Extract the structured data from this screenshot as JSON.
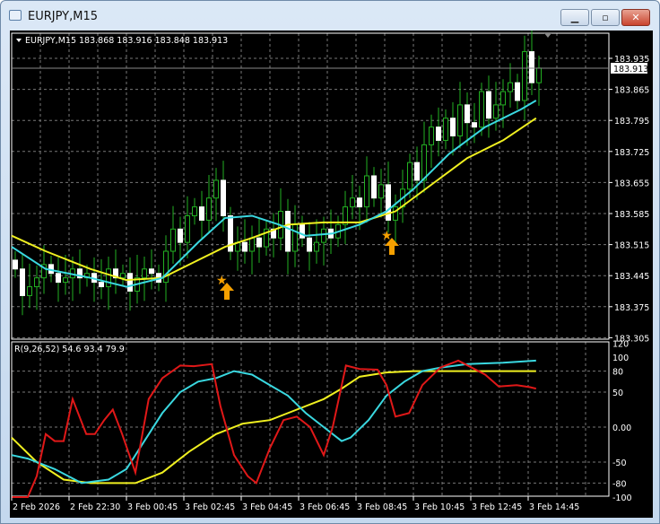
{
  "window": {
    "title": "EURJPY,M15",
    "minimize_icon": "minimize-icon",
    "maximize_icon": "maximize-icon",
    "close_icon": "close-icon"
  },
  "main": {
    "header": "EURJPY,M15  183.868 183.916 183.848 183.913",
    "current_price": "183.913",
    "price_labels": [
      "183.935",
      "183.865",
      "183.795",
      "183.725",
      "183.655",
      "183.585",
      "183.515",
      "183.445",
      "183.375",
      "183.305"
    ]
  },
  "indicator": {
    "header": "R(9,26,52) 54.6 93.4 79.9",
    "levels": [
      "120",
      "100",
      "80",
      "50",
      "0.00",
      "-50",
      "-80",
      "-100"
    ]
  },
  "time_labels": [
    "2 Feb 2026",
    "2 Feb 22:30",
    "3 Feb 00:45",
    "3 Feb 02:45",
    "3 Feb 04:45",
    "3 Feb 06:45",
    "3 Feb 08:45",
    "3 Feb 10:45",
    "3 Feb 12:45",
    "3 Feb 14:45"
  ],
  "colors": {
    "bull": "#ffffff",
    "bear": "#ffffff",
    "wick": "#22b022",
    "ma_fast": "#3ad8e0",
    "ma_slow": "#f0f020",
    "rsi_red": "#e01818",
    "rsi_cyan": "#3ad8e0",
    "rsi_yellow": "#f0f020",
    "signal": "#f5a000"
  },
  "chart_data": {
    "type": "candlestick",
    "symbol": "EURJPY",
    "timeframe": "M15",
    "ylim": [
      183.305,
      183.935
    ],
    "closes": [
      183.46,
      183.4,
      183.42,
      183.44,
      183.47,
      183.45,
      183.43,
      183.44,
      183.46,
      183.44,
      183.45,
      183.43,
      183.42,
      183.46,
      183.44,
      183.45,
      183.41,
      183.44,
      183.46,
      183.45,
      183.43,
      183.5,
      183.55,
      183.52,
      183.58,
      183.6,
      183.57,
      183.62,
      183.66,
      183.58,
      183.5,
      183.52,
      183.5,
      183.53,
      183.51,
      183.55,
      183.53,
      183.59,
      183.5,
      183.56,
      183.53,
      183.5,
      183.52,
      183.55,
      183.53,
      183.56,
      183.6,
      183.62,
      183.6,
      183.67,
      183.62,
      183.65,
      183.57,
      183.6,
      183.64,
      183.7,
      183.66,
      183.74,
      183.78,
      183.75,
      183.8,
      183.76,
      183.83,
      183.79,
      183.78,
      183.86,
      183.8,
      183.83,
      183.86,
      183.88,
      183.84,
      183.95,
      183.88,
      183.913
    ],
    "ma_fast": [
      [
        -0.5,
        183.51
      ],
      [
        4.25,
        183.46
      ],
      [
        10.5,
        183.44
      ],
      [
        15.5,
        183.42
      ],
      [
        20.5,
        183.44
      ],
      [
        25.5,
        183.52
      ],
      [
        29.25,
        183.575
      ],
      [
        33,
        183.58
      ],
      [
        36.75,
        183.56
      ],
      [
        40.5,
        183.535
      ],
      [
        44.25,
        183.54
      ],
      [
        48,
        183.56
      ],
      [
        51.75,
        183.59
      ],
      [
        55.5,
        183.64
      ],
      [
        60.5,
        183.72
      ],
      [
        65.5,
        183.78
      ],
      [
        70.5,
        183.82
      ],
      [
        72.6,
        183.84
      ]
    ],
    "ma_slow": [
      [
        -0.5,
        183.535
      ],
      [
        4.25,
        183.5
      ],
      [
        10.5,
        183.46
      ],
      [
        15.5,
        183.435
      ],
      [
        20.5,
        183.44
      ],
      [
        25.5,
        183.48
      ],
      [
        29.25,
        183.51
      ],
      [
        33,
        183.53
      ],
      [
        38,
        183.56
      ],
      [
        43,
        183.565
      ],
      [
        48,
        183.565
      ],
      [
        53,
        183.59
      ],
      [
        58,
        183.65
      ],
      [
        63,
        183.71
      ],
      [
        68,
        183.75
      ],
      [
        72.6,
        183.8
      ]
    ],
    "signals": [
      {
        "bar": 29.5,
        "type": "buy"
      },
      {
        "bar": 52.5,
        "type": "buy"
      }
    ],
    "indicator": {
      "ylim": [
        -100,
        120
      ],
      "red": [
        [
          -0.5,
          -100
        ],
        [
          1.75,
          -100
        ],
        [
          3,
          -70
        ],
        [
          4.25,
          -10
        ],
        [
          5.5,
          -20
        ],
        [
          6.75,
          -20
        ],
        [
          8,
          40
        ],
        [
          9.9,
          -10
        ],
        [
          11.1,
          -10
        ],
        [
          12.4,
          10
        ],
        [
          13.6,
          25
        ],
        [
          14.9,
          -10
        ],
        [
          16.75,
          -65
        ],
        [
          18.6,
          40
        ],
        [
          20.5,
          70
        ],
        [
          23,
          88
        ],
        [
          24.9,
          87
        ],
        [
          27.4,
          90
        ],
        [
          28.6,
          30
        ],
        [
          30.5,
          -40
        ],
        [
          32.4,
          -70
        ],
        [
          33.6,
          -80
        ],
        [
          35.5,
          -30
        ],
        [
          37.4,
          10
        ],
        [
          39.25,
          15
        ],
        [
          41.1,
          0
        ],
        [
          43,
          -40
        ],
        [
          44.25,
          0
        ],
        [
          46.1,
          88
        ],
        [
          48,
          83
        ],
        [
          50.5,
          82
        ],
        [
          51.75,
          60
        ],
        [
          53,
          15
        ],
        [
          54.9,
          20
        ],
        [
          56.75,
          60
        ],
        [
          59.25,
          85
        ],
        [
          61.75,
          95
        ],
        [
          65.5,
          75
        ],
        [
          67.4,
          58
        ],
        [
          69.9,
          60
        ],
        [
          71.75,
          57
        ],
        [
          72.6,
          55
        ]
      ],
      "cyan": [
        [
          -0.5,
          -40
        ],
        [
          1.75,
          -45
        ],
        [
          5.5,
          -60
        ],
        [
          9.25,
          -80
        ],
        [
          13,
          -75
        ],
        [
          15.5,
          -60
        ],
        [
          18,
          -20
        ],
        [
          20.5,
          20
        ],
        [
          23,
          50
        ],
        [
          25.5,
          65
        ],
        [
          28,
          70
        ],
        [
          30.5,
          80
        ],
        [
          33,
          75
        ],
        [
          35.5,
          60
        ],
        [
          38,
          45
        ],
        [
          40.5,
          20
        ],
        [
          43,
          0
        ],
        [
          45.5,
          -20
        ],
        [
          46.75,
          -15
        ],
        [
          49.25,
          10
        ],
        [
          51.75,
          45
        ],
        [
          54.25,
          65
        ],
        [
          56.75,
          80
        ],
        [
          59.25,
          85
        ],
        [
          63,
          90
        ],
        [
          68,
          92
        ],
        [
          72.6,
          95
        ]
      ],
      "yellow": [
        [
          -0.5,
          -15
        ],
        [
          3,
          -50
        ],
        [
          6.75,
          -75
        ],
        [
          10.5,
          -80
        ],
        [
          16.75,
          -80
        ],
        [
          20.5,
          -65
        ],
        [
          24.25,
          -35
        ],
        [
          28,
          -10
        ],
        [
          31.75,
          5
        ],
        [
          35.5,
          10
        ],
        [
          39.25,
          25
        ],
        [
          43,
          40
        ],
        [
          45.5,
          55
        ],
        [
          48,
          72
        ],
        [
          51.75,
          78
        ],
        [
          55.5,
          80
        ],
        [
          60.5,
          80
        ],
        [
          72.6,
          80
        ]
      ]
    }
  }
}
